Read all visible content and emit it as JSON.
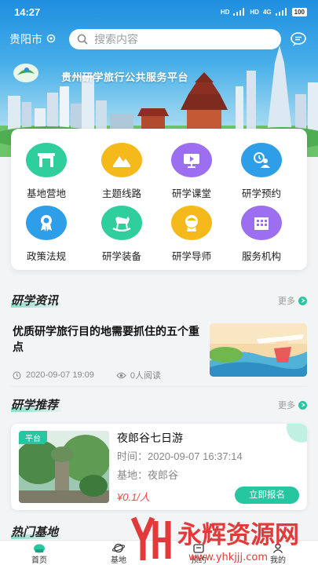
{
  "status": {
    "time": "14:27",
    "network_1": "HD",
    "network_2": "HD",
    "net_gen": "4G",
    "battery": "100"
  },
  "header": {
    "city": "贵阳市",
    "search_placeholder": "搜索内容"
  },
  "banner": {
    "title": "贵州研学旅行公共服务平台"
  },
  "menu": [
    {
      "label": "基地营地",
      "color": "#2ecf9c",
      "icon": "gate-icon"
    },
    {
      "label": "主题线路",
      "color": "#f5b91c",
      "icon": "mountain-icon"
    },
    {
      "label": "研学课堂",
      "color": "#9b6ff0",
      "icon": "video-icon"
    },
    {
      "label": "研学预约",
      "color": "#2f9ee8",
      "icon": "user-clock-icon"
    },
    {
      "label": "政策法规",
      "color": "#2f9ee8",
      "icon": "badge-icon"
    },
    {
      "label": "研学装备",
      "color": "#2ecf9c",
      "icon": "rocking-horse-icon"
    },
    {
      "label": "研学导师",
      "color": "#f5b91c",
      "icon": "teacher-icon"
    },
    {
      "label": "服务机构",
      "color": "#9b6ff0",
      "icon": "building-icon"
    }
  ],
  "news_section": {
    "title": "研学资讯",
    "more": "更多"
  },
  "news": {
    "title": "优质研学旅行目的地需要抓住的五个重点",
    "time": "2020-09-07 19:09",
    "views": "0人阅读"
  },
  "recommend_section": {
    "title": "研学推荐",
    "more": "更多"
  },
  "recommend": {
    "tag": "平台",
    "title": "夜郎谷七日游",
    "time": "时间：2020-09-07 16:37:14",
    "base": "基地：夜郎谷",
    "price": "¥0.1/人",
    "button": "立即报名"
  },
  "hot_section": {
    "title": "热门基地"
  },
  "tabs": [
    {
      "label": "首页"
    },
    {
      "label": "基地"
    },
    {
      "label": "预约"
    },
    {
      "label": "我的"
    }
  ],
  "watermark": {
    "brand": "永辉资源网",
    "url": "www.yhkjjj.com"
  },
  "colors": {
    "accent": "#26c7a0",
    "price": "#f04848"
  }
}
